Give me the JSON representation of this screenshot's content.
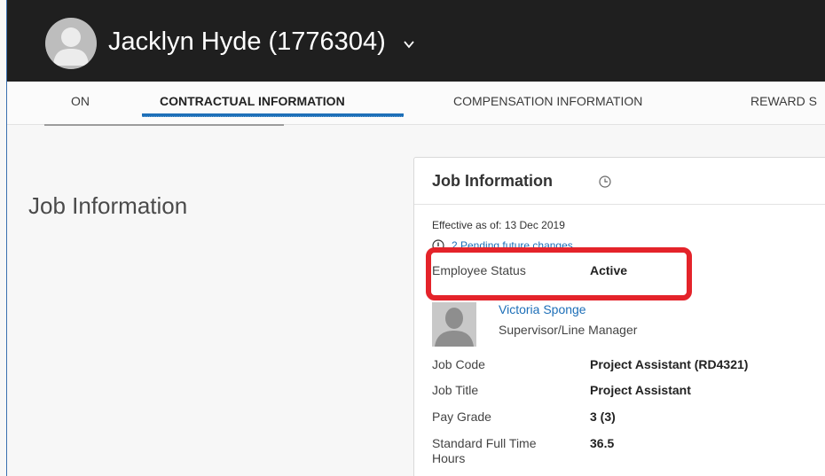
{
  "header": {
    "employee_name": "Jacklyn Hyde (1776304)",
    "avatar_icon": "person-silhouette-icon",
    "chevron_icon": "chevron-down-icon"
  },
  "tabs": [
    {
      "label": "ON",
      "active": false
    },
    {
      "label": "CONTRACTUAL INFORMATION",
      "active": true
    },
    {
      "label": "COMPENSATION INFORMATION",
      "active": false
    },
    {
      "label": "REWARD S",
      "active": false
    }
  ],
  "section": {
    "label": "Job Information"
  },
  "card": {
    "title": "Job Information",
    "history_icon": "clock-history-icon",
    "effective_as_of": "Effective as of: 13 Dec 2019",
    "pending_changes": "2 Pending future changes",
    "employee_status": {
      "label": "Employee Status",
      "value": "Active"
    },
    "supervisor": {
      "name": "Victoria Sponge",
      "role": "Supervisor/Line Manager"
    },
    "fields": [
      {
        "label": "Job Code",
        "value": "Project Assistant (RD4321)"
      },
      {
        "label": "Job Title",
        "value": "Project Assistant"
      },
      {
        "label": "Pay Grade",
        "value": "3 (3)"
      },
      {
        "label": "Standard Full Time Hours",
        "value": "36.5"
      }
    ]
  },
  "colors": {
    "header_bg": "#1f1f1f",
    "accent": "#1d6fb8",
    "highlight": "#e4232a"
  }
}
